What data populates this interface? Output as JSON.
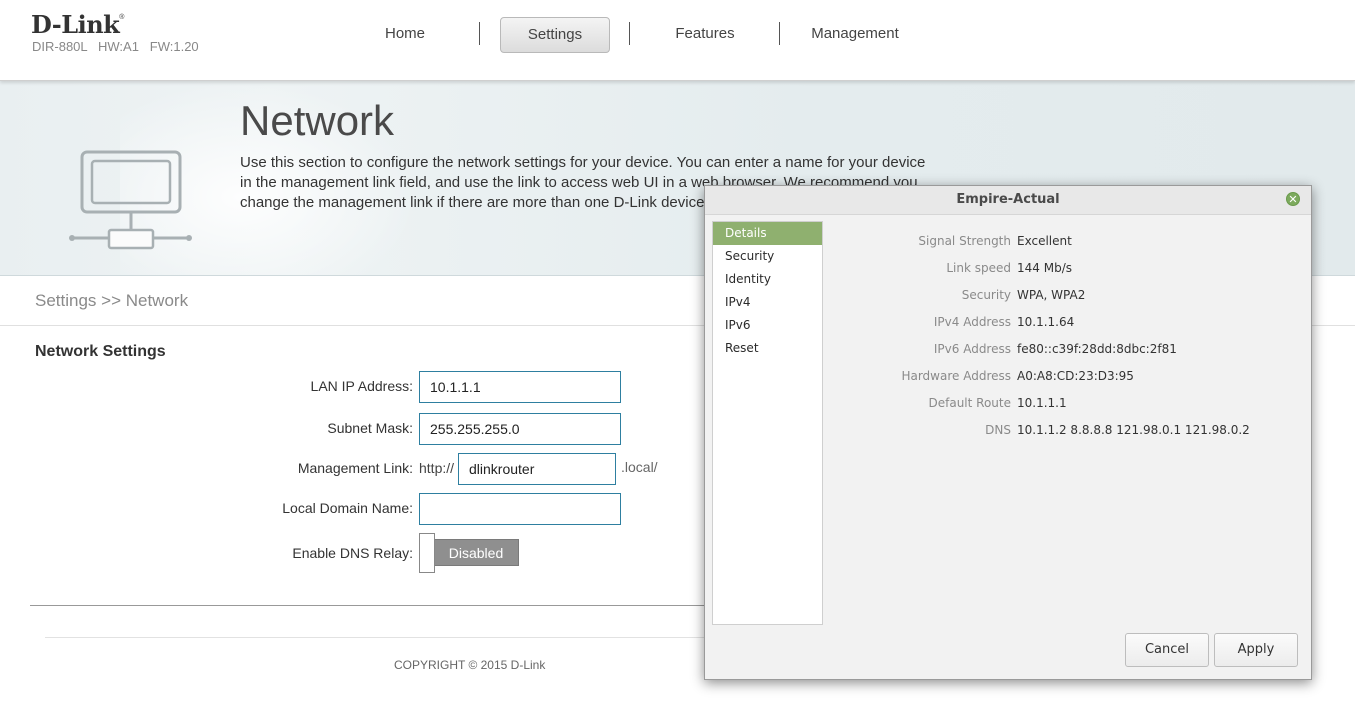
{
  "header": {
    "logo_text": "D-Link",
    "logo_mark": "®",
    "model_info": "DIR-880L   HW:A1   FW:1.20",
    "nav": [
      {
        "label": "Home"
      },
      {
        "label": "Settings",
        "active": true
      },
      {
        "label": "Features"
      },
      {
        "label": "Management"
      }
    ]
  },
  "banner": {
    "icon": "computer-network-icon",
    "title": "Network",
    "description": "Use this section to configure the network settings for your device. You can enter a name for your device in the management link field, and use the link to access web UI in a web browser. We recommend you change the management link if there are more than one D-Link devices"
  },
  "breadcrumb": "Settings >> Network",
  "form": {
    "section_title": "Network Settings",
    "lan_ip": {
      "label": "LAN IP Address:",
      "value": "10.1.1.1"
    },
    "subnet": {
      "label": "Subnet Mask:",
      "value": "255.255.255.0"
    },
    "mgmt_link": {
      "label": "Management Link:",
      "prefix": "http://",
      "value": "dlinkrouter",
      "suffix": ".local/"
    },
    "local_domain": {
      "label": "Local Domain Name:",
      "value": ""
    },
    "dns_relay": {
      "label": "Enable DNS Relay:",
      "state": "Disabled"
    }
  },
  "footer": {
    "copyright": "COPYRIGHT © 2015 D-Link"
  },
  "dialog": {
    "title": "Empire-Actual",
    "close_icon": "close-icon",
    "sidebar": [
      "Details",
      "Security",
      "Identity",
      "IPv4",
      "IPv6",
      "Reset"
    ],
    "active_tab": "Details",
    "details": [
      {
        "label": "Signal Strength",
        "value": "Excellent"
      },
      {
        "label": "Link speed",
        "value": "144 Mb/s"
      },
      {
        "label": "Security",
        "value": "WPA, WPA2"
      },
      {
        "label": "IPv4 Address",
        "value": "10.1.1.64"
      },
      {
        "label": "IPv6 Address",
        "value": "fe80::c39f:28dd:8dbc:2f81"
      },
      {
        "label": "Hardware Address",
        "value": "A0:A8:CD:23:D3:95"
      },
      {
        "label": "Default Route",
        "value": "10.1.1.1"
      },
      {
        "label": "DNS",
        "value": "10.1.1.2 8.8.8.8 121.98.0.1 121.98.0.2"
      }
    ],
    "buttons": {
      "cancel": "Cancel",
      "apply": "Apply"
    },
    "colors": {
      "accent": "#8fb06f"
    }
  }
}
